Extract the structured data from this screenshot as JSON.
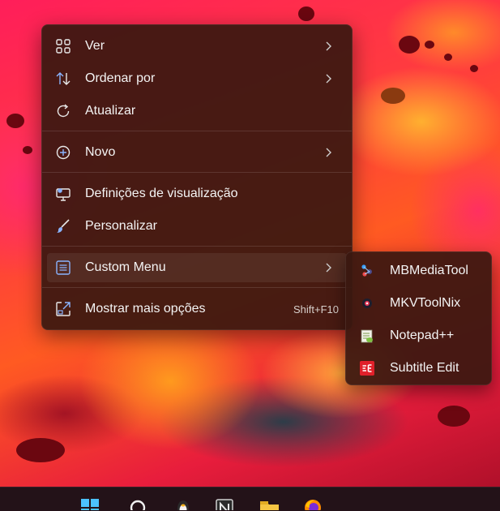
{
  "context_menu": {
    "items": [
      {
        "label": "Ver",
        "icon": "grid-view-icon",
        "has_submenu": true
      },
      {
        "label": "Ordenar por",
        "icon": "sort-arrows-icon",
        "has_submenu": true
      },
      {
        "label": "Atualizar",
        "icon": "refresh-icon",
        "has_submenu": false
      },
      {
        "label": "Novo",
        "icon": "plus-circle-icon",
        "has_submenu": true
      },
      {
        "label": "Definições de visualização",
        "icon": "display-settings-icon",
        "has_submenu": false
      },
      {
        "label": "Personalizar",
        "icon": "brush-icon",
        "has_submenu": false
      },
      {
        "label": "Custom Menu",
        "icon": "list-menu-icon",
        "has_submenu": true,
        "highlighted": true
      },
      {
        "label": "Mostrar mais opções",
        "icon": "expand-icon",
        "has_submenu": false,
        "shortcut": "Shift+F10"
      }
    ]
  },
  "submenu": {
    "items": [
      {
        "label": "MBMediaTool",
        "icon": "mbmediatool-icon"
      },
      {
        "label": "MKVToolNix",
        "icon": "mkvtoolnix-icon"
      },
      {
        "label": "Notepad++",
        "icon": "notepad-plus-plus-icon"
      },
      {
        "label": "Subtitle Edit",
        "icon": "subtitle-edit-icon"
      }
    ]
  },
  "taskbar": {
    "icons": [
      "windows-start-icon",
      "search-icon",
      "tux-icon",
      "notion-icon",
      "file-explorer-icon",
      "firefox-icon"
    ]
  },
  "colors": {
    "menu_bg": "#3a1810",
    "text": "#f4f4f4",
    "accent_icon": "#8ab4ff"
  }
}
